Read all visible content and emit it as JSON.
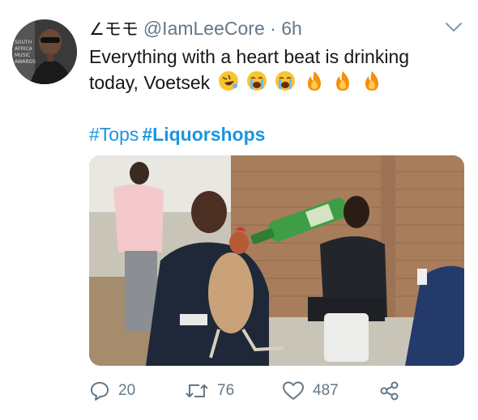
{
  "tweet": {
    "display_name": "∠モモ",
    "handle": "@IamLeeCore",
    "separator": "·",
    "time": "6h",
    "text": "Everything with a heart beat is drinking today, Voetsek",
    "emojis": [
      "rofl-emoji",
      "loudly-crying-emoji",
      "loudly-crying-emoji",
      "fire-emoji",
      "fire-emoji",
      "fire-emoji"
    ],
    "hashtags": [
      "#Tops",
      "#Liquorshops"
    ],
    "avatar_badge_text": [
      "SOUTH",
      "AFRICA",
      "MUSIC",
      "AWARDS"
    ]
  },
  "actions": {
    "reply_count": "20",
    "retweet_count": "76",
    "like_count": "487"
  },
  "colors": {
    "link": "#1b95e0",
    "secondary_text": "#657786",
    "primary_text": "#14171a"
  },
  "icons": {
    "reply": "speech-bubble-icon",
    "retweet": "retweet-arrows-icon",
    "like": "heart-icon",
    "share": "share-nodes-icon",
    "caret": "chevron-down-icon"
  }
}
